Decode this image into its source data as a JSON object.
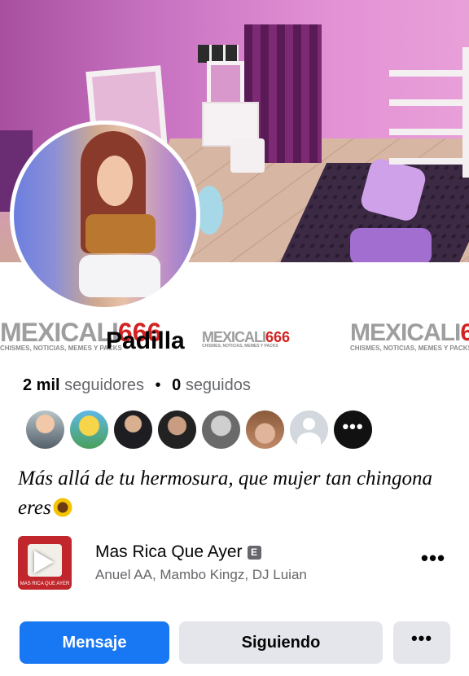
{
  "profile": {
    "name": "Padilla",
    "followers_count": "2 mil",
    "followers_label": "seguidores",
    "separator": "•",
    "following_count": "0",
    "following_label": "seguidos",
    "bio": "Más allá de tu hermosura, que mujer tan chingona eres"
  },
  "watermark": {
    "brand_gray": "MEXICALI",
    "brand_red": "666",
    "tagline": "CHISMES, NOTICIAS, MEMES Y PACKS"
  },
  "mutual_friends": {
    "more_glyph": "•••"
  },
  "music": {
    "song_title": "Mas Rica Que Ayer",
    "explicit_badge": "E",
    "artists": "Anuel AA, Mambo Kingz, DJ Luian",
    "album_caption": "MAS RICA QUE AYER",
    "more_glyph": "•••"
  },
  "actions": {
    "message_label": "Mensaje",
    "following_label": "Siguiendo",
    "more_glyph": "•••"
  },
  "colors": {
    "primary_button": "#1877f2",
    "secondary_button": "#e4e6eb",
    "secondary_text": "#65676b",
    "watermark_red": "#d32121"
  }
}
